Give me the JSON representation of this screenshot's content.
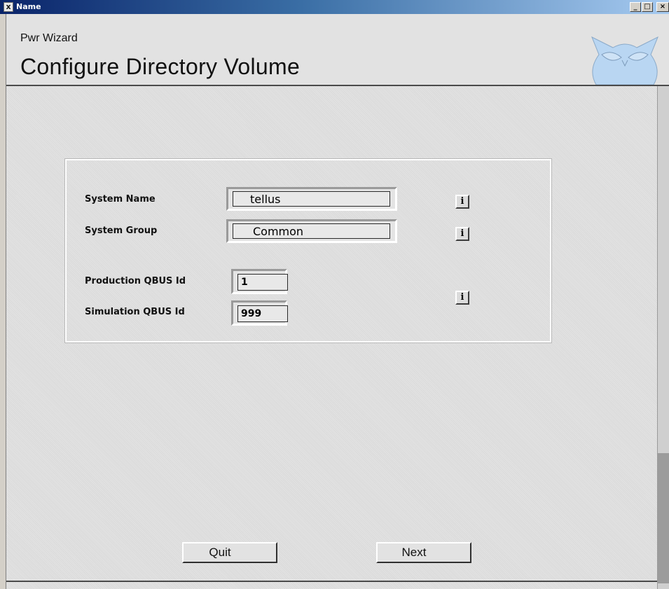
{
  "window": {
    "title": "Name",
    "app_icon": "x-app-icon",
    "controls": {
      "minimize": "_",
      "maximize": "□",
      "close": "×"
    }
  },
  "header": {
    "subtitle": "Pwr Wizard",
    "title": "Configure Directory Volume",
    "logo": "owl-logo"
  },
  "form": {
    "system_name": {
      "label": "System Name",
      "value": "tellus"
    },
    "system_group": {
      "label": "System Group",
      "value": "Common"
    },
    "production_qbus": {
      "label": "Production QBUS Id",
      "value": "1"
    },
    "simulation_qbus": {
      "label": "Simulation QBUS Id",
      "value": "999"
    },
    "info_icon": "i"
  },
  "buttons": {
    "quit": "Quit",
    "next": "Next"
  },
  "colors": {
    "titlebar_start": "#0a246a",
    "titlebar_end": "#a6caf0",
    "panel_background": "#e0e0e0",
    "owl_fill": "#b9d6f2"
  }
}
